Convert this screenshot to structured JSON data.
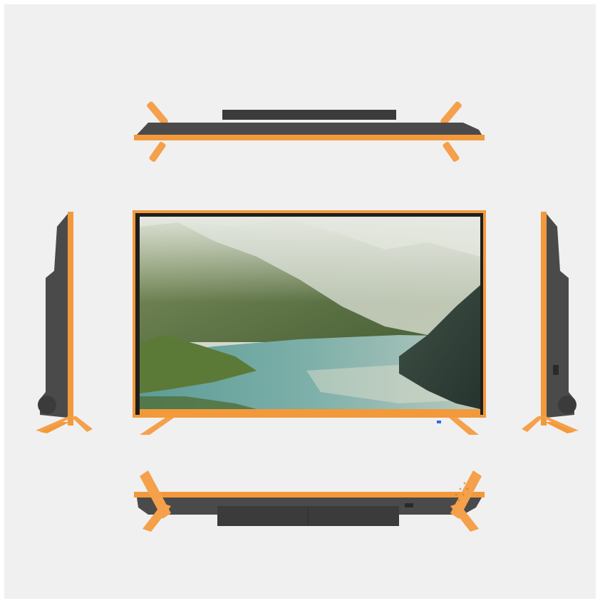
{
  "image": {
    "subject": "tv-product-views",
    "views": [
      "top-view",
      "front-view",
      "left-side-view",
      "right-side-view",
      "bottom-view"
    ]
  },
  "colors": {
    "page_background": "#f0f0f0",
    "outer_background": "#ffffff",
    "frame_accent": "#f29a3b",
    "stand_accent": "#f5a04a",
    "body_dark": "#4a4a4a",
    "body_darker": "#3b3b3b",
    "screen_bezel": "#1e1e1e",
    "led_indicator": "#2f6de0"
  }
}
